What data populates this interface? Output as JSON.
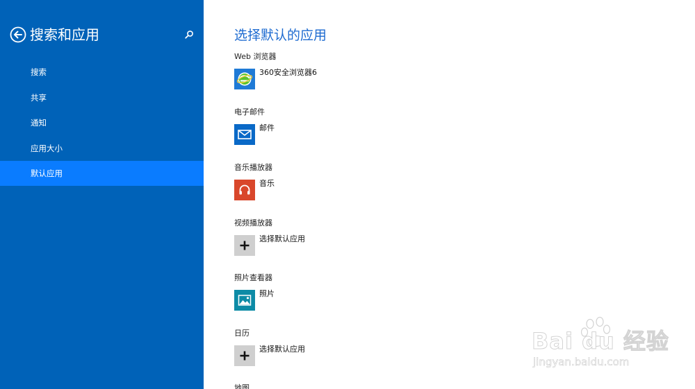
{
  "sidebar": {
    "title": "搜索和应用",
    "items": [
      {
        "label": "搜索"
      },
      {
        "label": "共享"
      },
      {
        "label": "通知"
      },
      {
        "label": "应用大小"
      },
      {
        "label": "默认应用",
        "active": true
      }
    ],
    "background": "#0062b8",
    "active_color": "#0a7cff"
  },
  "main": {
    "title": "选择默认的应用",
    "title_color": "#1e6bd0",
    "sections": [
      {
        "label": "Web 浏览器",
        "app": "360安全浏览器6",
        "icon": "browser-360-icon"
      },
      {
        "label": "电子邮件",
        "app": "邮件",
        "icon": "mail-icon"
      },
      {
        "label": "音乐播放器",
        "app": "音乐",
        "icon": "headphones-icon"
      },
      {
        "label": "视频播放器",
        "app": "选择默认应用",
        "icon": "plus-icon"
      },
      {
        "label": "照片查看器",
        "app": "照片",
        "icon": "photo-icon"
      },
      {
        "label": "日历",
        "app": "选择默认应用",
        "icon": "plus-icon"
      },
      {
        "label": "地图"
      }
    ]
  },
  "watermark": {
    "brand": "Bai du 经验",
    "url": "jingyan.baidu.com"
  }
}
